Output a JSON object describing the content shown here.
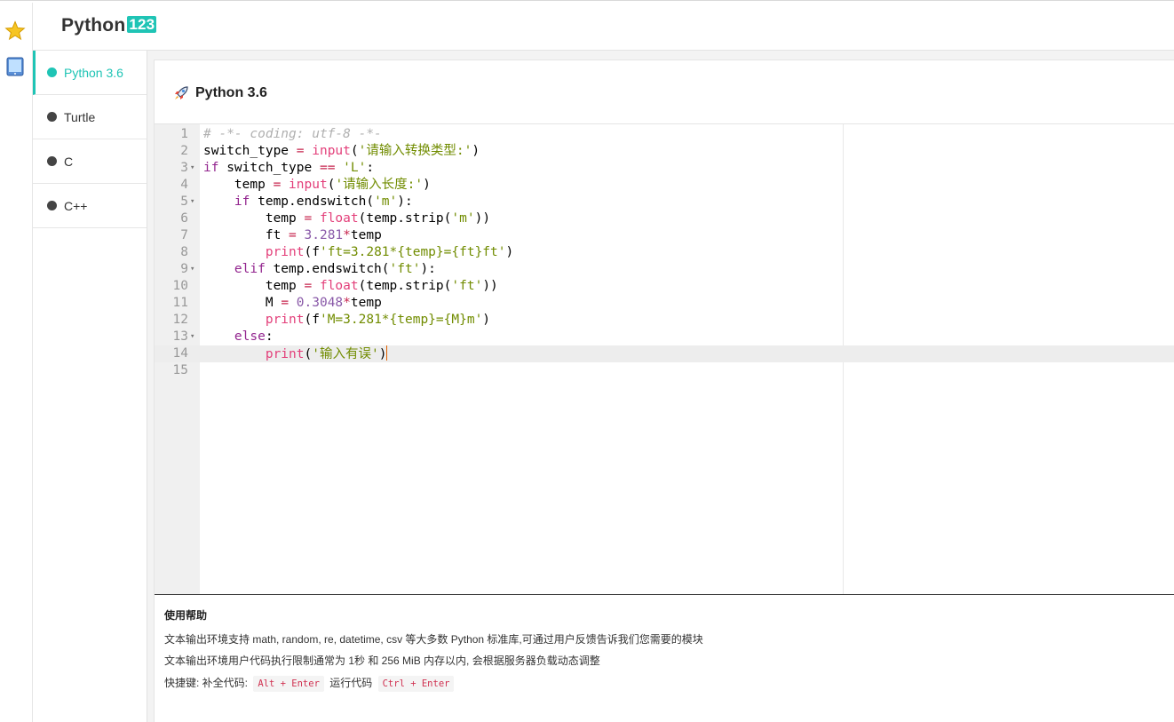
{
  "app": {
    "logo_text": "Python",
    "logo_badge": "123"
  },
  "rail": {
    "icons": [
      "star-icon",
      "tablet-icon"
    ]
  },
  "sidebar": {
    "items": [
      {
        "label": "Python 3.6",
        "active": true
      },
      {
        "label": "Turtle",
        "active": false
      },
      {
        "label": "C",
        "active": false
      },
      {
        "label": "C++",
        "active": false
      }
    ]
  },
  "panel": {
    "title": "Python 3.6",
    "title_icon": "rocket-icon"
  },
  "editor": {
    "active_line": 14,
    "lines": [
      {
        "n": "1",
        "text": "# -*- coding: utf-8 -*-"
      },
      {
        "n": "2",
        "text": "switch_type = input('请输入转换类型:')"
      },
      {
        "n": "3",
        "text": "if switch_type == 'L':"
      },
      {
        "n": "4",
        "text": "    temp = input('请输入长度:')"
      },
      {
        "n": "5",
        "text": "    if temp.endswitch('m'):"
      },
      {
        "n": "6",
        "text": "        temp = float(temp.strip('m'))"
      },
      {
        "n": "7",
        "text": "        ft = 3.281*temp"
      },
      {
        "n": "8",
        "text": "        print(f'ft=3.281*{temp}={ft}ft')"
      },
      {
        "n": "9",
        "text": "    elif temp.endswitch('ft'):"
      },
      {
        "n": "10",
        "text": "        temp = float(temp.strip('ft'))"
      },
      {
        "n": "11",
        "text": "        M = 0.3048*temp"
      },
      {
        "n": "12",
        "text": "        print(f'M=3.281*{temp}={M}m')"
      },
      {
        "n": "13",
        "text": "    else:"
      },
      {
        "n": "14",
        "text": "        print('输入有误')"
      },
      {
        "n": "15",
        "text": "    "
      }
    ]
  },
  "help": {
    "title": "使用帮助",
    "line1": "文本输出环境支持 math, random, re, datetime, csv 等大多数 Python 标准库,可通过用户反馈告诉我们您需要的模块",
    "line2": "文本输出环境用户代码执行限制通常为 1秒 和 256 MiB 内存以内, 会根据服务器负载动态调整",
    "shortcut_prefix": "快捷键: 补全代码:",
    "shortcut_complete": "Alt + Enter",
    "shortcut_run_label": "运行代码",
    "shortcut_run": "Ctrl + Enter"
  }
}
